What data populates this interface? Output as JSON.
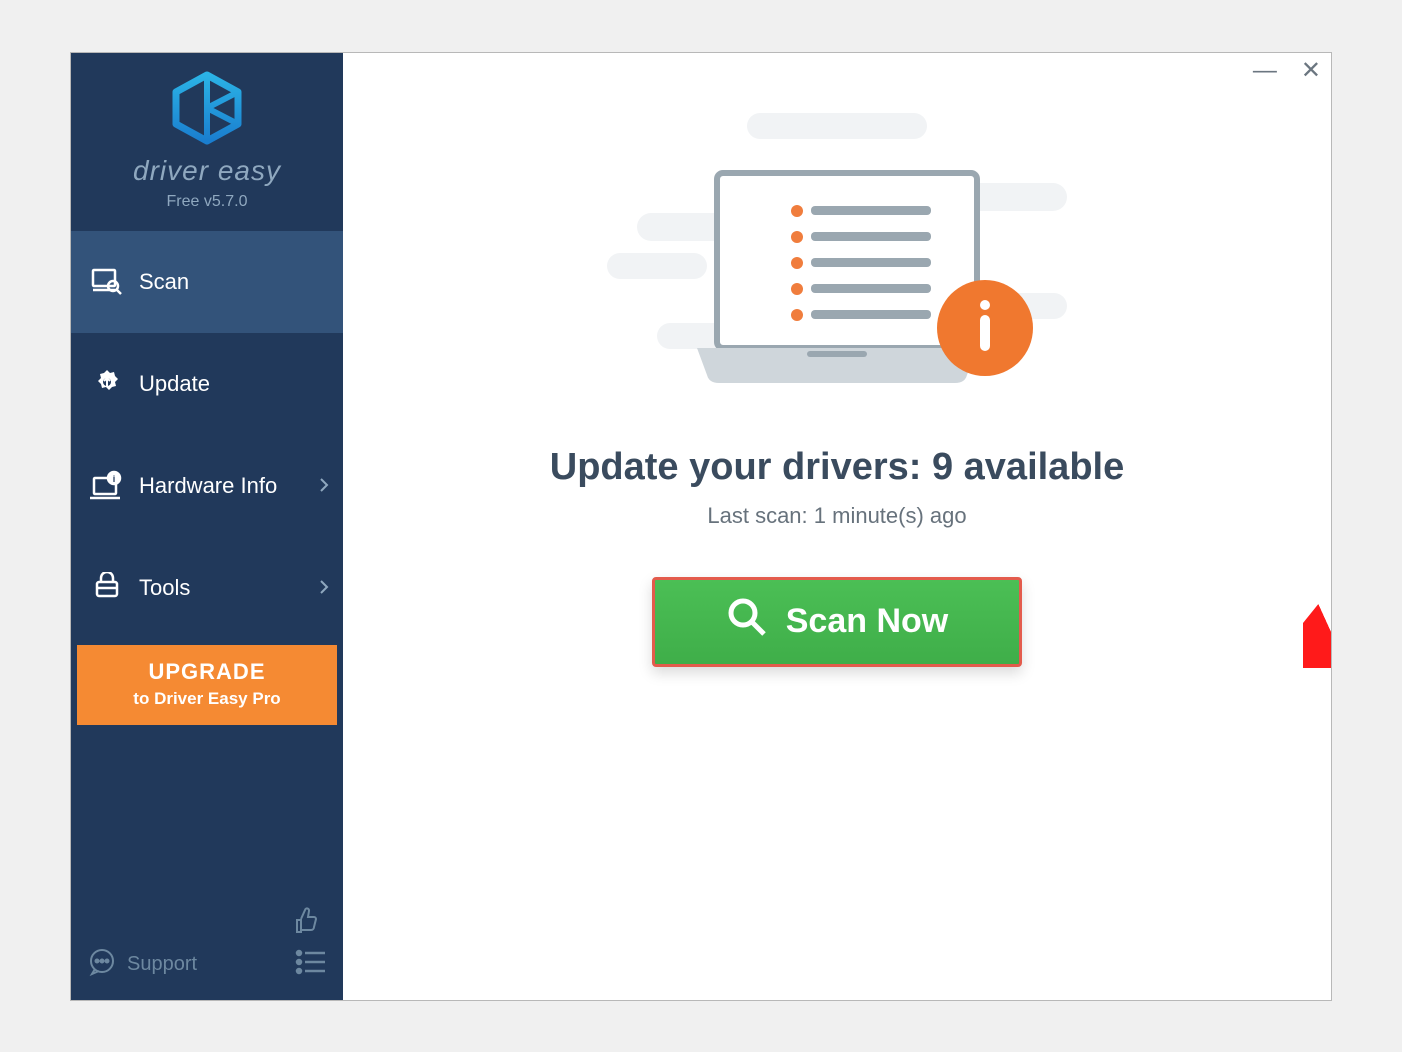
{
  "brand": {
    "name": "driver easy",
    "version": "Free v5.7.0"
  },
  "sidebar": {
    "items": [
      {
        "label": "Scan",
        "icon": "scan-icon",
        "active": true
      },
      {
        "label": "Update",
        "icon": "gear-icon"
      },
      {
        "label": "Hardware Info",
        "icon": "hardware-icon",
        "chevron": true
      },
      {
        "label": "Tools",
        "icon": "tools-icon",
        "chevron": true
      }
    ],
    "upgrade": {
      "line1": "UPGRADE",
      "line2": "to Driver Easy Pro"
    },
    "support": "Support"
  },
  "main": {
    "headline": "Update your drivers: 9 available",
    "subline": "Last scan: 1 minute(s) ago",
    "scan_button": "Scan Now"
  },
  "colors": {
    "sidebar_bg": "#21395b",
    "accent_orange": "#f58a33",
    "scan_green": "#4bbf55",
    "highlight_red": "#e35b4c"
  }
}
